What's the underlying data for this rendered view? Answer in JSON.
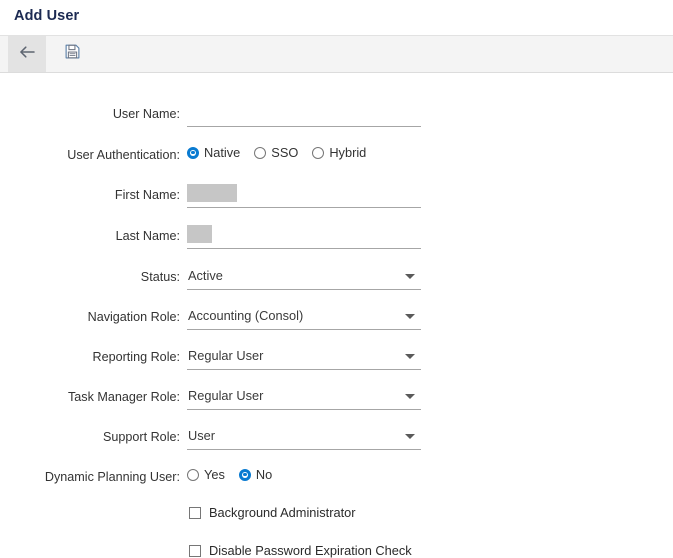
{
  "page": {
    "title": "Add User"
  },
  "toolbar": {
    "back_icon": "arrow-left-icon",
    "save_icon": "save-floppy-icon"
  },
  "form": {
    "rows": [
      {
        "label": "User Name:",
        "type": "text",
        "value": ""
      },
      {
        "label": "User Authentication:",
        "type": "radio",
        "options": [
          "Native",
          "SSO",
          "Hybrid"
        ],
        "selected": "Native"
      },
      {
        "label": "First Name:",
        "type": "redacted",
        "value": "",
        "redaction": "wide"
      },
      {
        "label": "Last Name:",
        "type": "redacted",
        "value": "",
        "redaction": "short"
      },
      {
        "label": "Status:",
        "type": "select",
        "value": "Active"
      },
      {
        "label": "Navigation Role:",
        "type": "select",
        "value": "Accounting (Consol)"
      },
      {
        "label": "Reporting Role:",
        "type": "select",
        "value": "Regular User"
      },
      {
        "label": "Task Manager Role:",
        "type": "select",
        "value": "Regular User"
      },
      {
        "label": "Support Role:",
        "type": "select",
        "value": "User"
      },
      {
        "label": "Dynamic Planning User:",
        "type": "radio",
        "options": [
          "Yes",
          "No"
        ],
        "selected": "No"
      }
    ],
    "checkboxes": [
      {
        "label": "Background Administrator",
        "checked": false
      },
      {
        "label": "Disable Password Expiration Check",
        "checked": false
      }
    ]
  },
  "colors": {
    "title": "#1c2a52",
    "accent": "#0a7bd1",
    "toolbar_bg": "#f4f4f4",
    "back_btn_bg": "#e3e3e3",
    "underline": "#a6a6a6",
    "redaction": "#c6c6c6"
  }
}
